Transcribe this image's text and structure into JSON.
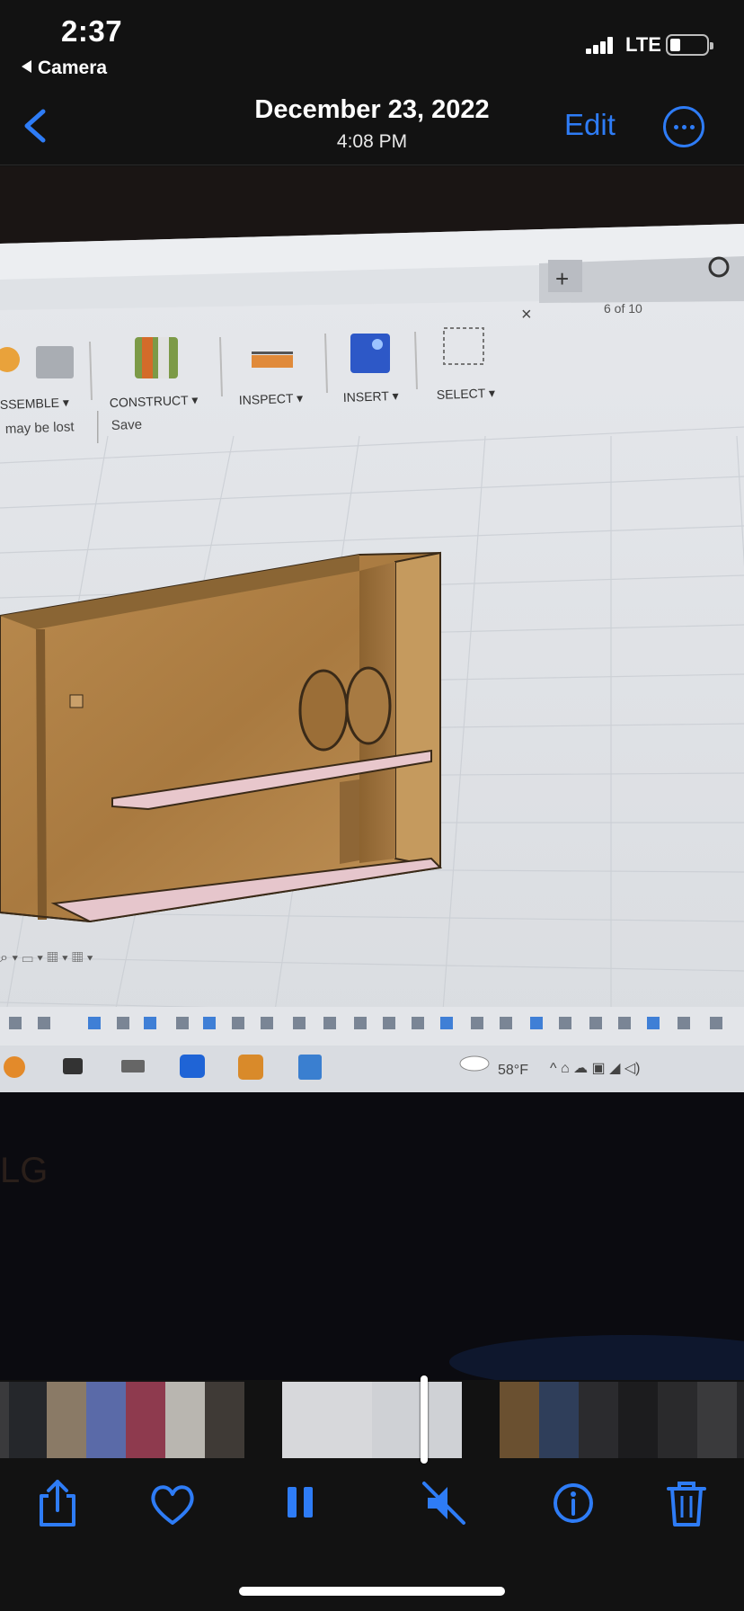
{
  "status_bar": {
    "time": "2:37",
    "back_app": "Camera",
    "network": "LTE"
  },
  "nav": {
    "date": "December 23, 2022",
    "time": "4:08 PM",
    "edit_label": "Edit"
  },
  "photo": {
    "screen_tab_info": "6 of 10",
    "ribbon": {
      "assemble": "SSEMBLE ▾",
      "construct": "CONSTRUCT ▾",
      "inspect": "INSPECT ▾",
      "insert": "INSERT ▾",
      "select": "SELECT ▾"
    },
    "notice_text": "may be lost",
    "save_label": "Save",
    "taskbar_weather": "58°F",
    "monitor_brand": "LG"
  },
  "toolbar_icons": [
    "share-icon",
    "heart-icon",
    "pause-icon",
    "mute-icon",
    "info-icon",
    "trash-icon"
  ],
  "colors": {
    "accent": "#2e7cf6",
    "background": "#121212"
  }
}
